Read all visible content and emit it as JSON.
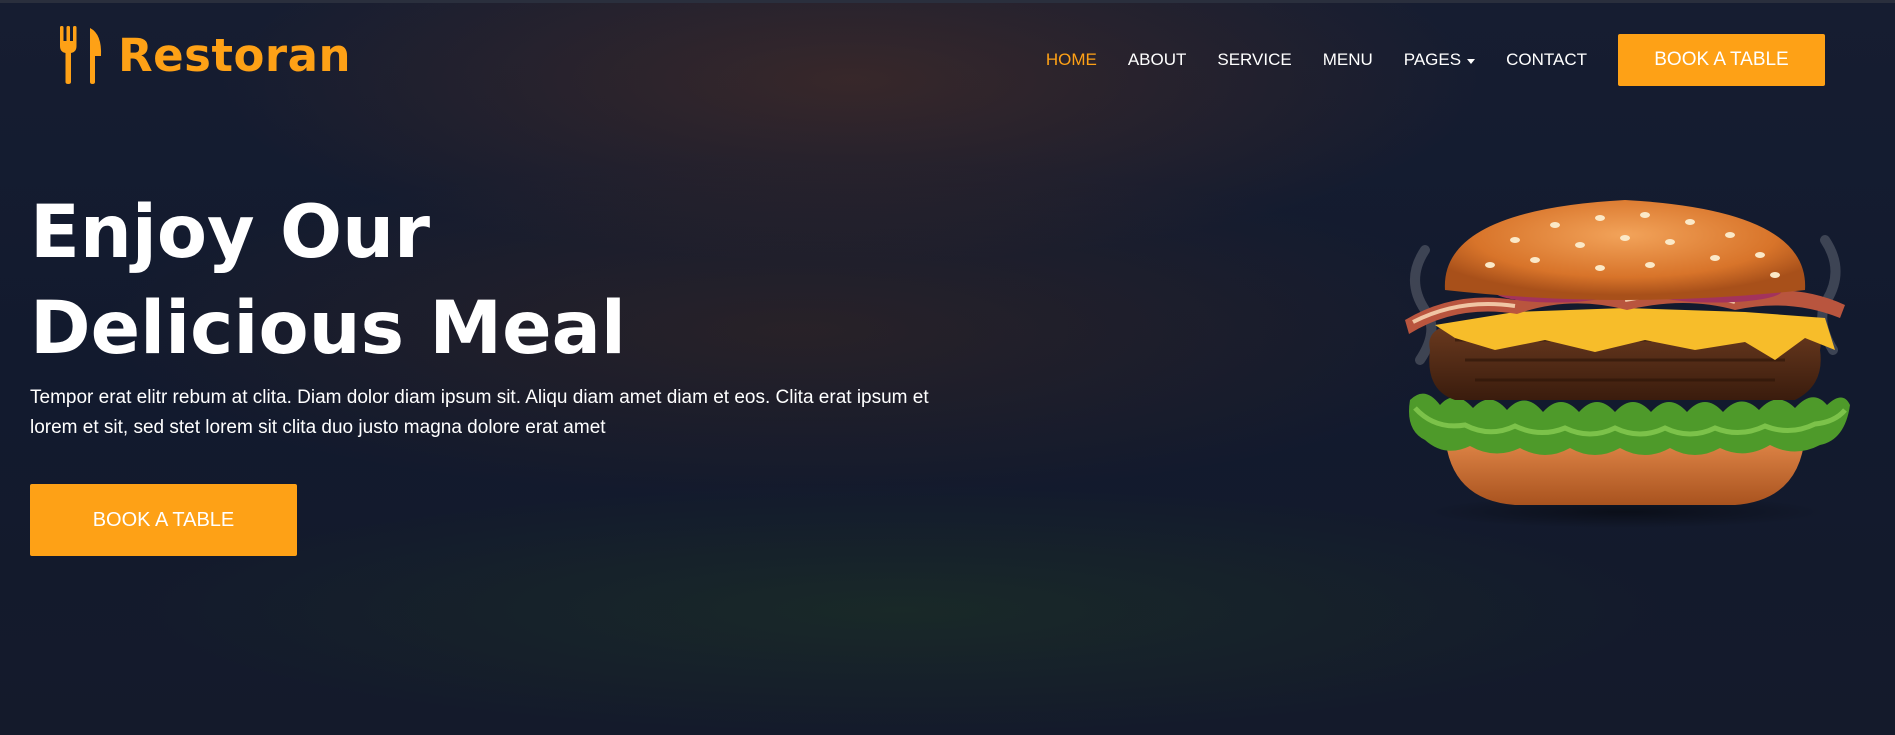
{
  "brand": {
    "name": "Restoran",
    "icon": "utensils-icon",
    "color": "#fea116"
  },
  "nav": {
    "links": [
      {
        "label": "HOME",
        "active": true
      },
      {
        "label": "ABOUT",
        "active": false
      },
      {
        "label": "SERVICE",
        "active": false
      },
      {
        "label": "MENU",
        "active": false
      },
      {
        "label": "PAGES",
        "active": false,
        "dropdown": true
      },
      {
        "label": "CONTACT",
        "active": false
      }
    ],
    "cta_label": "BOOK A TABLE"
  },
  "hero": {
    "title_line1": "Enjoy Our",
    "title_line2": "Delicious Meal",
    "text": "Tempor erat elitr rebum at clita. Diam dolor diam ipsum sit. Aliqu diam amet diam et eos. Clita erat ipsum et lorem et sit, sed stet lorem sit clita duo justo magna dolore erat amet",
    "cta_label": "BOOK A TABLE",
    "image": "burger-image"
  },
  "colors": {
    "accent": "#fea116",
    "background": "#0f1729",
    "text": "#ffffff"
  }
}
